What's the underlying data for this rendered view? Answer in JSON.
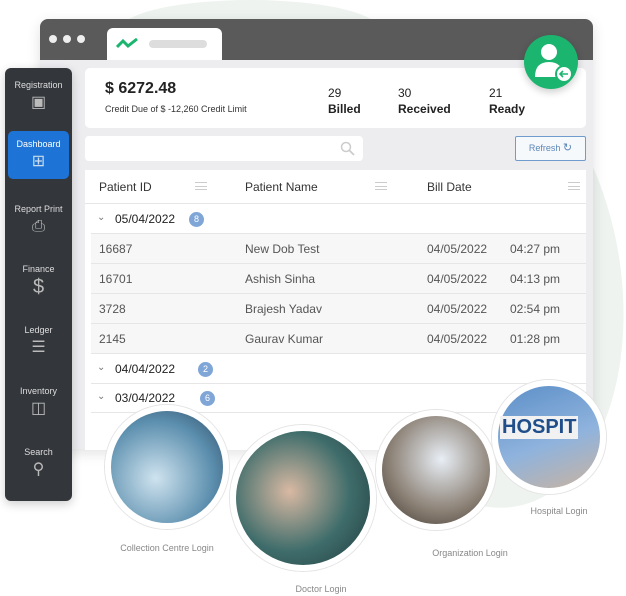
{
  "sidebar": {
    "items": [
      {
        "label": "Registration",
        "icon": "monitor-plus-icon"
      },
      {
        "label": "Dashboard",
        "icon": "grid-icon",
        "active": true
      },
      {
        "label": "Report Print",
        "icon": "printer-icon"
      },
      {
        "label": "Finance",
        "icon": "dollar-icon"
      },
      {
        "label": "Ledger",
        "icon": "list-icon"
      },
      {
        "label": "Inventory",
        "icon": "box-icon"
      },
      {
        "label": "Search",
        "icon": "search-icon"
      }
    ]
  },
  "summary": {
    "amount": "$ 6272.48",
    "credit": "Credit Due of $ -12,260 Credit Limit",
    "stats": [
      {
        "value": "29",
        "label": "Billed"
      },
      {
        "value": "30",
        "label": "Received"
      },
      {
        "value": "21",
        "label": "Ready"
      }
    ]
  },
  "toolbar": {
    "search_placeholder": "",
    "refresh": "Refresh"
  },
  "table": {
    "headers": [
      "Patient ID",
      "Patient Name",
      "Bill Date"
    ],
    "groups": [
      {
        "date": "05/04/2022",
        "count": "8",
        "rows": [
          [
            "16687",
            "New Dob Test",
            "04/05/2022",
            "04:27 pm"
          ],
          [
            "16701",
            "Ashish Sinha",
            "04/05/2022",
            "04:13 pm"
          ],
          [
            "3728",
            "Brajesh Yadav",
            "04/05/2022",
            "02:54 pm"
          ],
          [
            "2145",
            "Gaurav Kumar",
            "04/05/2022",
            "01:28 pm"
          ]
        ]
      },
      {
        "date": "04/04/2022",
        "count": "2"
      },
      {
        "date": "03/04/2022",
        "count": "6"
      }
    ]
  },
  "logins": [
    "Collection Centre Login",
    "Doctor Login",
    "Organization Login",
    "Hospital Login"
  ],
  "hospital_sign": "HOSPIT",
  "colors": {
    "accent": "#1e73d6",
    "green": "#1cb56f",
    "sidebar": "#33363b"
  }
}
